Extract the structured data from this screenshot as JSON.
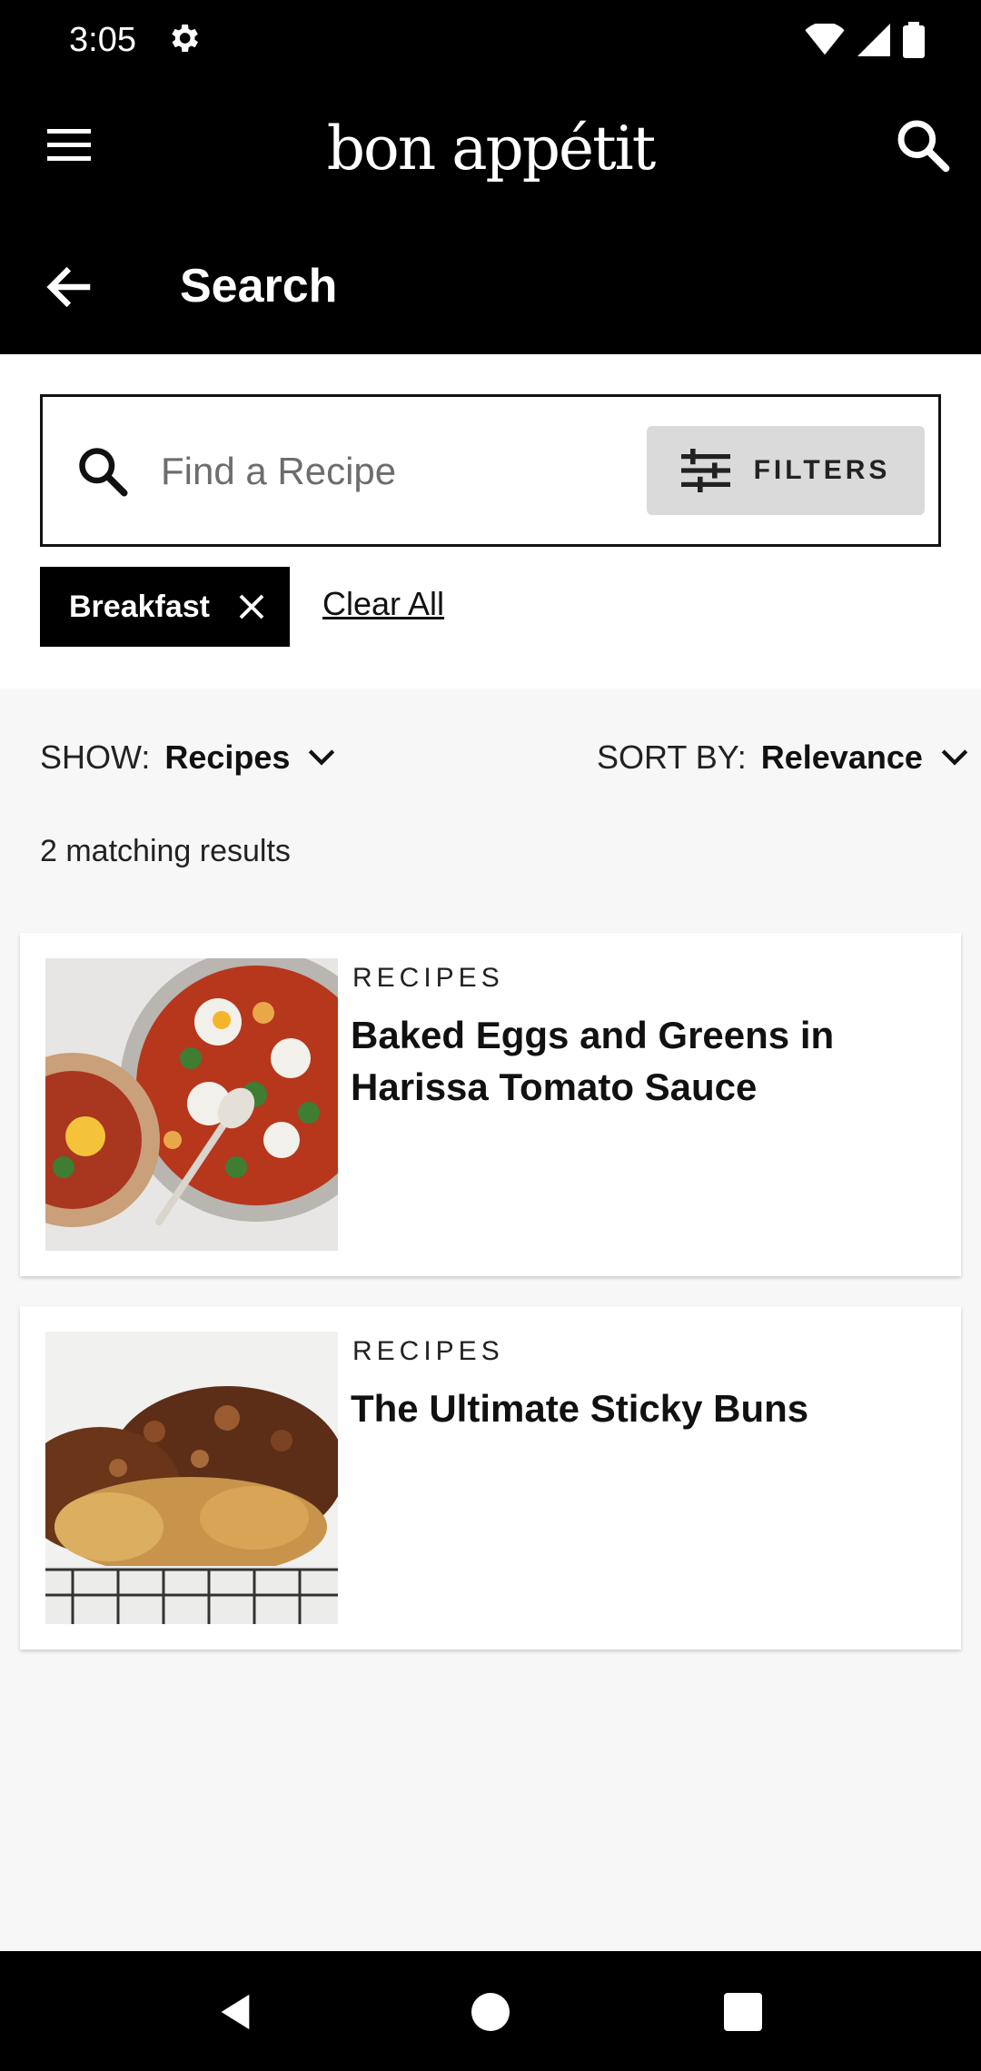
{
  "status_bar": {
    "time": "3:05"
  },
  "app_bar": {
    "logo": "bon appétit"
  },
  "sub_header": {
    "title": "Search"
  },
  "search": {
    "placeholder": "Find a Recipe",
    "filters_label": "FILTERS",
    "active_chip": "Breakfast",
    "clear_all": "Clear All"
  },
  "controls": {
    "show_label": "SHOW:",
    "show_value": "Recipes",
    "sort_label": "SORT BY:",
    "sort_value": "Relevance"
  },
  "results_text": "2 matching results",
  "results": [
    {
      "kicker": "RECIPES",
      "title": "Baked Eggs and Greens in Harissa Tomato Sauce",
      "image": "baked-eggs-shakshuka-photo"
    },
    {
      "kicker": "RECIPES",
      "title": "The Ultimate Sticky Buns",
      "image": "sticky-buns-photo"
    }
  ],
  "colors": {
    "bar": "#000000",
    "page_bg": "#f7f7f7",
    "filters_bg": "#dadada",
    "text": "#111111"
  }
}
